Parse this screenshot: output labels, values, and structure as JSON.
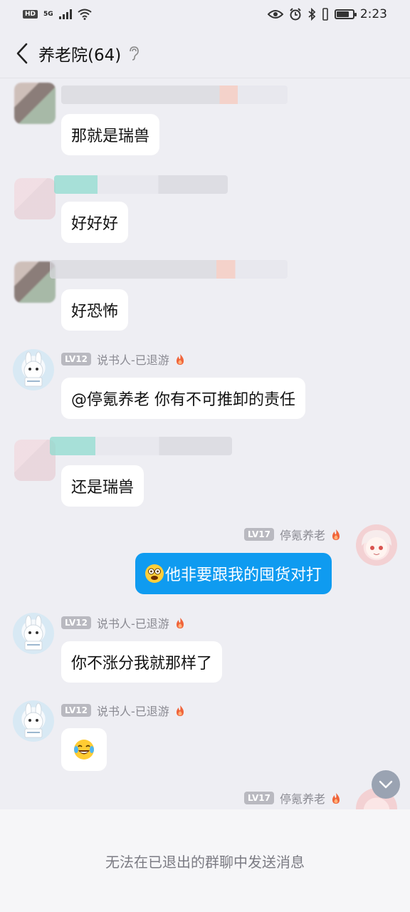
{
  "status_bar": {
    "hd": "HD",
    "network": "5G",
    "time": "2:23",
    "battery_level": 0.8
  },
  "header": {
    "title": "养老院(64)"
  },
  "users": {
    "storyteller": {
      "level": "LV12",
      "name": "说书人-已退游"
    },
    "me": {
      "level": "LV17",
      "name": "停氪养老"
    }
  },
  "messages": [
    {
      "text": "那就是瑞兽"
    },
    {
      "text": "好好好"
    },
    {
      "text": "好恐怖"
    },
    {
      "text": "@停氪养老 你有不可推卸的责任"
    },
    {
      "text": "还是瑞兽"
    },
    {
      "text": "他非要跟我的囤货对打",
      "emoji": "dizzy-face-emoji"
    },
    {
      "text": "你不涨分我就那样了"
    },
    {
      "text": "😂",
      "emoji": "tears-of-joy-emoji"
    }
  ],
  "footer": {
    "notice": "无法在已退出的群聊中发送消息"
  },
  "colors": {
    "background": "#eeeef3",
    "bubble_other": "#ffffff",
    "bubble_mine": "#0f9bf0",
    "level_badge": "#b9b9c0",
    "flame": "#f0643a"
  }
}
